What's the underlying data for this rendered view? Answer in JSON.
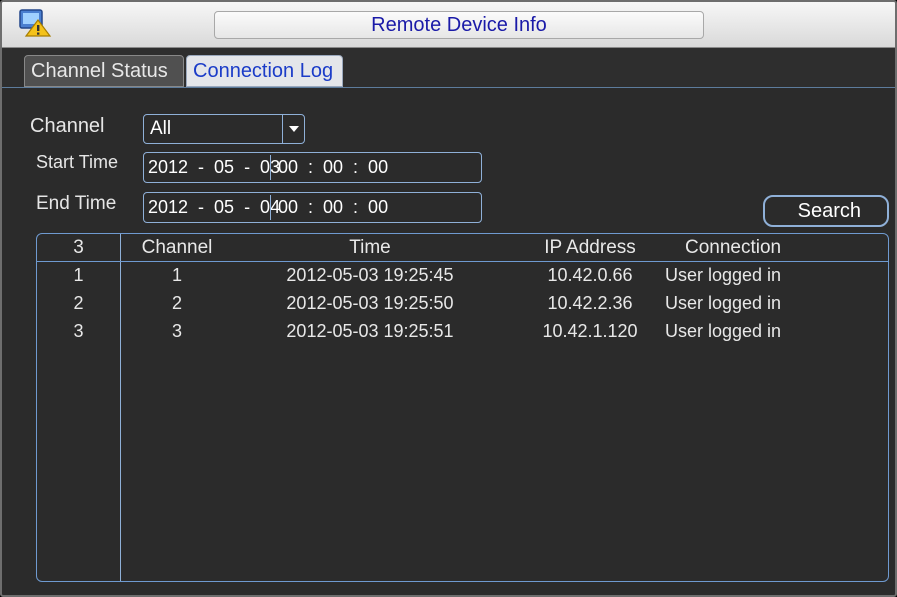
{
  "window": {
    "title": "Remote Device Info"
  },
  "tabs": [
    {
      "label": "Channel Status",
      "active": false
    },
    {
      "label": "Connection Log",
      "active": true
    }
  ],
  "filters": {
    "channel_label": "Channel",
    "channel_value": "All",
    "start_label": "Start Time",
    "start_date": "2012  -  05  -  03",
    "start_time": "00  :  00  :  00",
    "end_label": "End Time",
    "end_date": "2012  -  05  -  04",
    "end_time": "00  :  00  :  00",
    "search_label": "Search"
  },
  "table": {
    "columns": [
      "3",
      "Channel",
      "Time",
      "IP Address",
      "Connection"
    ],
    "rows": [
      [
        "1",
        "1",
        "2012-05-03 19:25:45",
        "10.42.0.66",
        "User logged in"
      ],
      [
        "2",
        "2",
        "2012-05-03 19:25:50",
        "10.42.2.36",
        "User logged in"
      ],
      [
        "3",
        "3",
        "2012-05-03 19:25:51",
        "10.42.1.120",
        "User logged in"
      ]
    ]
  },
  "colors": {
    "background": "#2b2b2b",
    "border_accent": "#8fb0d8",
    "title_text": "#1a1aa8",
    "active_tab_text": "#1b3cc8"
  },
  "icons": {
    "app": "device-info-icon",
    "dropdown": "chevron-down-icon"
  }
}
